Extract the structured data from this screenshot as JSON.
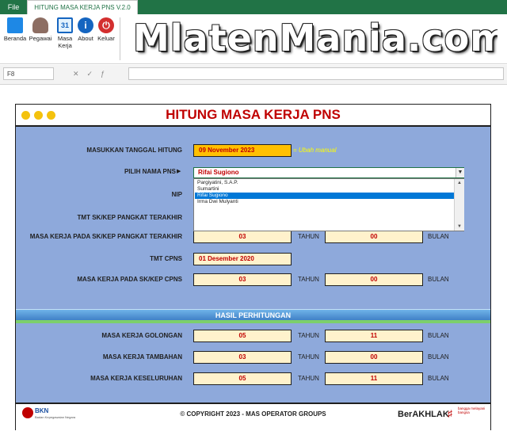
{
  "ribbon": {
    "file_tab": "File",
    "app_tab": "HITUNG MASA KERJA PNS V.2.0",
    "buttons": [
      {
        "label": "Beranda",
        "icon": "windows-icon",
        "color": "#1e88e5"
      },
      {
        "label": "Pegawai",
        "icon": "people-icon",
        "color": "#5d4037"
      },
      {
        "label": "Masa\nKerja",
        "icon": "calendar-icon",
        "color": "#1565c0"
      },
      {
        "label": "About",
        "icon": "info-icon",
        "color": "#1565c0"
      },
      {
        "label": "Keluar",
        "icon": "power-icon",
        "color": "#d32f2f"
      }
    ],
    "watermark": "MlatenMania.com"
  },
  "formula_bar": {
    "name_box": "F8",
    "formula": ""
  },
  "form": {
    "title": "HITUNG MASA KERJA PNS",
    "date_label": "MASUKKAN TANGGAL HITUNG",
    "date_value": "09 November 2023",
    "date_note": "= Ubah manual",
    "pns_label": "PILIH NAMA PNS",
    "pns_value": "Rifai Sugiono",
    "pns_options": [
      "Pargiyatini, S.A.P.",
      "Sumartini",
      "Rifai Sugiono",
      "Irma Dwi Mulyanti"
    ],
    "nip_label": "NIP",
    "tmt_pangkat_label": "TMT SK/KEP PANGKAT TERAKHIR",
    "mk_pangkat_label": "MASA KERJA PADA SK/KEP PANGKAT TERAKHIR",
    "mk_pangkat_tahun": "03",
    "mk_pangkat_bulan": "00",
    "tmt_cpns_label": "TMT CPNS",
    "tmt_cpns_value": "01 Desember 2020",
    "mk_cpns_label": "MASA KERJA PADA SK/KEP CPNS",
    "mk_cpns_tahun": "03",
    "mk_cpns_bulan": "00",
    "tahun": "TAHUN",
    "bulan": "BULAN"
  },
  "results": {
    "header": "HASIL PERHITUNGAN",
    "golongan_label": "MASA KERJA GOLONGAN",
    "golongan_tahun": "05",
    "golongan_bulan": "11",
    "tambahan_label": "MASA KERJA TAMBAHAN",
    "tambahan_tahun": "03",
    "tambahan_bulan": "00",
    "keseluruhan_label": "MASA KERJA KESELURUHAN",
    "keseluruhan_tahun": "05",
    "keseluruhan_bulan": "11"
  },
  "footer": {
    "copyright": "© COPYRIGHT 2023 - MAS OPERATOR GROUPS",
    "bkn": "BKN",
    "bkn_sub": "Badan Kepegawaian Negara",
    "berakhlak": "BerAKHLAK",
    "berakhlak_sub": "bangga melayani bangsa"
  },
  "colors": {
    "excel_green": "#217346",
    "panel": "#8ea9db",
    "title_red": "#c00000",
    "field": "#fff2cc",
    "date_field": "#ffc000"
  }
}
